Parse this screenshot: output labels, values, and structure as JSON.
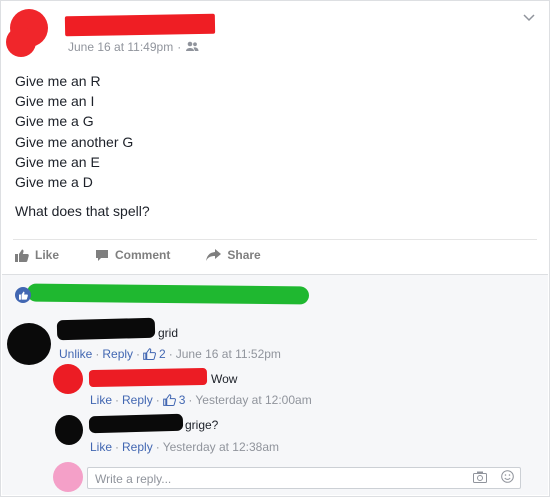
{
  "post": {
    "timestamp": "June 16 at 11:49pm",
    "audience_icon": "friends-icon",
    "lines": [
      "Give me an R",
      "Give me an I",
      "Give me a G",
      "Give me another G",
      "Give me an E",
      "Give me a D"
    ],
    "question": "What does that spell?"
  },
  "actions": {
    "like": "Like",
    "comment": "Comment",
    "share": "Share"
  },
  "comments": [
    {
      "text": "grid",
      "unlike": "Unlike",
      "reply": "Reply",
      "likes": "2",
      "time": "June 16 at 11:52pm"
    },
    {
      "text": "Wow",
      "like": "Like",
      "reply": "Reply",
      "likes": "3",
      "time": "Yesterday at 12:00am"
    },
    {
      "text": "grige?",
      "like": "Like",
      "reply": "Reply",
      "time": "Yesterday at 12:38am"
    }
  ],
  "reply_box": {
    "placeholder": "Write a reply..."
  },
  "colors": {
    "link": "#4267b2",
    "muted": "#90949c",
    "redact_red": "#ec1c24",
    "redact_green": "#1fb830",
    "redact_black": "#0a0a0a"
  }
}
